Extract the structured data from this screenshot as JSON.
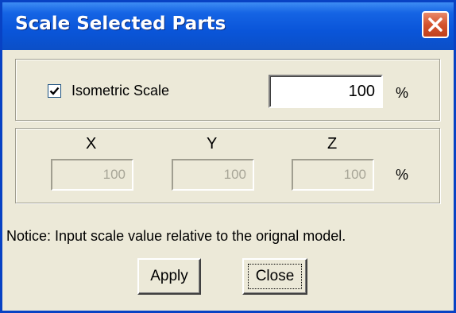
{
  "window": {
    "title": "Scale Selected Parts",
    "title_bar_color": "#0a55d9"
  },
  "isometric": {
    "checkbox_label": "Isometric Scale",
    "checked": true,
    "value": "100",
    "unit": "%"
  },
  "axes": {
    "x": {
      "label": "X",
      "value": "100"
    },
    "y": {
      "label": "Y",
      "value": "100"
    },
    "z": {
      "label": "Z",
      "value": "100"
    },
    "unit": "%"
  },
  "notice": "Notice: Input scale value relative to the orignal model.",
  "buttons": {
    "apply": "Apply",
    "close": "Close"
  }
}
